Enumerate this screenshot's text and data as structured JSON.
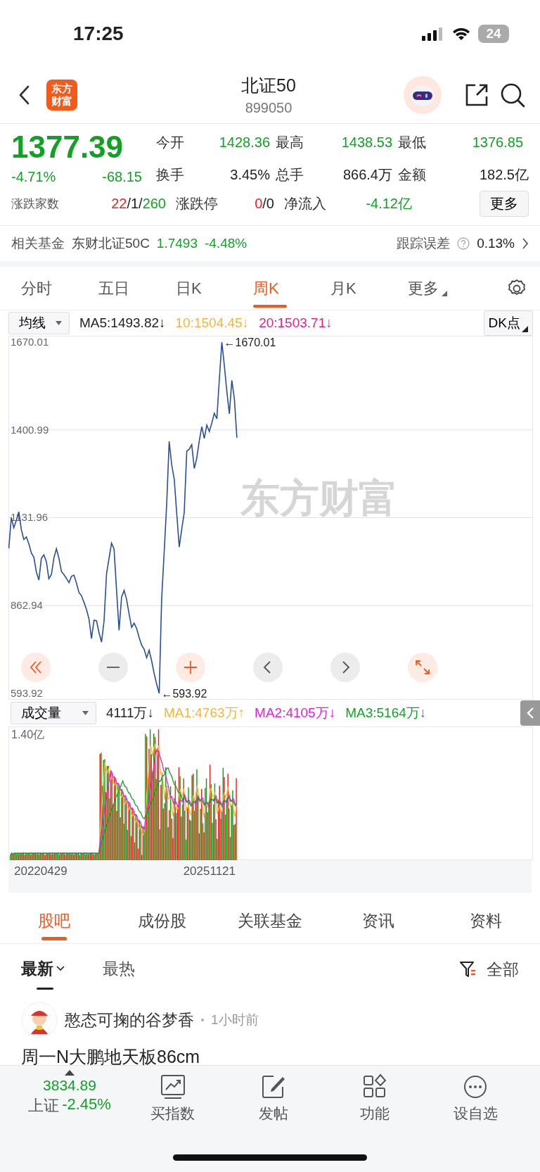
{
  "status_bar": {
    "time": "17:25",
    "battery": "24"
  },
  "header": {
    "logo_lines": [
      "东方",
      "财富"
    ],
    "title": "北证50",
    "code": "899050"
  },
  "quote": {
    "price": "1377.39",
    "change_pct": "-4.71%",
    "change": "-68.15",
    "color": "#13a026",
    "stats": [
      {
        "label": "今开",
        "value": "1428.36",
        "color": "#13a026"
      },
      {
        "label": "最高",
        "value": "1438.53",
        "color": "#13a026"
      },
      {
        "label": "最低",
        "value": "1376.85",
        "color": "#13a026"
      },
      {
        "label": "换手",
        "value": "3.45%",
        "color": "#222222"
      },
      {
        "label": "总手",
        "value": "866.4万",
        "color": "#222222"
      },
      {
        "label": "金额",
        "value": "182.5亿",
        "color": "#222222"
      }
    ],
    "breadth": {
      "label": "涨跌家数",
      "parts": [
        {
          "text": "22",
          "color": "#e6272b"
        },
        {
          "text": "/1/",
          "color": "#222222"
        },
        {
          "text": "260",
          "color": "#13a026"
        }
      ]
    },
    "limit": {
      "label": "涨跌停",
      "parts": [
        {
          "text": "0",
          "color": "#e6272b"
        },
        {
          "text": "/0",
          "color": "#222222"
        }
      ]
    },
    "net_inflow": {
      "label": "净流入",
      "value": "-4.12亿",
      "color": "#13a026"
    },
    "more_button": "更多"
  },
  "fund": {
    "label": "相关基金",
    "name": "东财北证50C",
    "price": "1.7493",
    "change": "-4.48%",
    "color": "#13a026",
    "tracking_label": "跟踪误差",
    "tracking_value": "0.13%"
  },
  "period_tabs": [
    {
      "label": "分时",
      "selected": false,
      "dropdown": false
    },
    {
      "label": "五日",
      "selected": false,
      "dropdown": false
    },
    {
      "label": "日K",
      "selected": false,
      "dropdown": false
    },
    {
      "label": "周K",
      "selected": true,
      "dropdown": false
    },
    {
      "label": "月K",
      "selected": false,
      "dropdown": false
    },
    {
      "label": "更多",
      "selected": false,
      "dropdown": true
    }
  ],
  "indicator_bar": {
    "selector": "均线",
    "items": [
      {
        "text": "MA5:1493.82↓",
        "color": "#222222"
      },
      {
        "text": "10:1504.45↓",
        "color": "#f5b43c"
      },
      {
        "text": "20:1503.71↓",
        "color": "#e0218a"
      }
    ],
    "button": "DK点"
  },
  "price_chart": {
    "watermark": "东方财富",
    "chart_data": {
      "type": "line",
      "ylim": [
        574.5,
        1689.4
      ],
      "yticks": [
        593.92,
        862.94,
        1131.96,
        1400.99,
        1670.01
      ],
      "grid": true,
      "series": [
        {
          "color": "#2a4f95",
          "values": [
            1038,
            1133,
            1101,
            1124,
            1150,
            1096,
            1065,
            1073,
            1052,
            1024,
            1011,
            966,
            941,
            1007,
            1018,
            997,
            945,
            958,
            1009,
            1037,
            1008,
            967,
            958,
            946,
            933,
            952,
            956,
            932,
            903,
            893,
            873,
            851,
            821,
            762,
            818,
            816,
            780,
            751,
            816,
            960,
            1008,
            1054,
            1036,
            909,
            787,
            889,
            909,
            882,
            837,
            796,
            809,
            793,
            765,
            742,
            729,
            703,
            726,
            693,
            655,
            622,
            594,
            883,
            1027,
            1176,
            1366,
            1294,
            1250,
            1146,
            1042,
            1097,
            1148,
            1336,
            1342,
            1356,
            1283,
            1314,
            1367,
            1411,
            1375,
            1416,
            1396,
            1422,
            1452,
            1435,
            1555,
            1670,
            1597,
            1519,
            1450,
            1553,
            1497,
            1377,
            null,
            null,
            null,
            null,
            null,
            null,
            null,
            null,
            null,
            null,
            null,
            null,
            null,
            null,
            null,
            null,
            null,
            null,
            null,
            null,
            null,
            null,
            null,
            null,
            null,
            null,
            null,
            null,
            null,
            null,
            null,
            null,
            null,
            null,
            null,
            null,
            null,
            null,
            null,
            null,
            null,
            null,
            null,
            null,
            null,
            null,
            null,
            null,
            null,
            null,
            null,
            null,
            null,
            null,
            null,
            null,
            null,
            null,
            null,
            null,
            null,
            null,
            null,
            null,
            null,
            null,
            null,
            null,
            null,
            null,
            null,
            null,
            null,
            null,
            null,
            null,
            null,
            null,
            null,
            null,
            null,
            null,
            null,
            null,
            null,
            null,
            null,
            null,
            null,
            null,
            null,
            null,
            null,
            null,
            null,
            null,
            null,
            null,
            null,
            null,
            null,
            null,
            null,
            null,
            null,
            null,
            null,
            null,
            null,
            null,
            null,
            null,
            null,
            null,
            null,
            null,
            null,
            null
          ]
        }
      ],
      "annotations": [
        "←1670.01",
        "←593.92"
      ]
    }
  },
  "volume": {
    "selector": "成交量",
    "items": [
      {
        "text": "4111万↓",
        "color": "#222222"
      },
      {
        "text": "MA1:4763万↑",
        "color": "#f5b43c"
      },
      {
        "text": "MA2:4105万↓",
        "color": "#e020e0"
      },
      {
        "text": "MA3:5164万↓",
        "color": "#13a026"
      }
    ],
    "axis_label": "1.40亿",
    "dates": [
      "20220429",
      "20251121"
    ]
  },
  "content_tabs": [
    {
      "label": "股吧",
      "selected": true
    },
    {
      "label": "成份股",
      "selected": false
    },
    {
      "label": "关联基金",
      "selected": false
    },
    {
      "label": "资讯",
      "selected": false
    },
    {
      "label": "资料",
      "selected": false
    }
  ],
  "sort_tabs": [
    {
      "label": "最新",
      "selected": true
    },
    {
      "label": "最热",
      "selected": false
    }
  ],
  "filter": "全部",
  "post": {
    "author": "憨态可掬的谷梦香",
    "time": "1小时前",
    "title": "周一N大鹏地天板86cm"
  },
  "bottom_bar": {
    "index_value": "3834.89",
    "index_name": "上证",
    "index_change": "-2.45%",
    "color": "#13a026",
    "items": [
      {
        "label": "买指数",
        "kind": "chart"
      },
      {
        "label": "发帖",
        "kind": "edit"
      },
      {
        "label": "功能",
        "kind": "apps"
      },
      {
        "label": "设自选",
        "kind": "more"
      }
    ]
  }
}
